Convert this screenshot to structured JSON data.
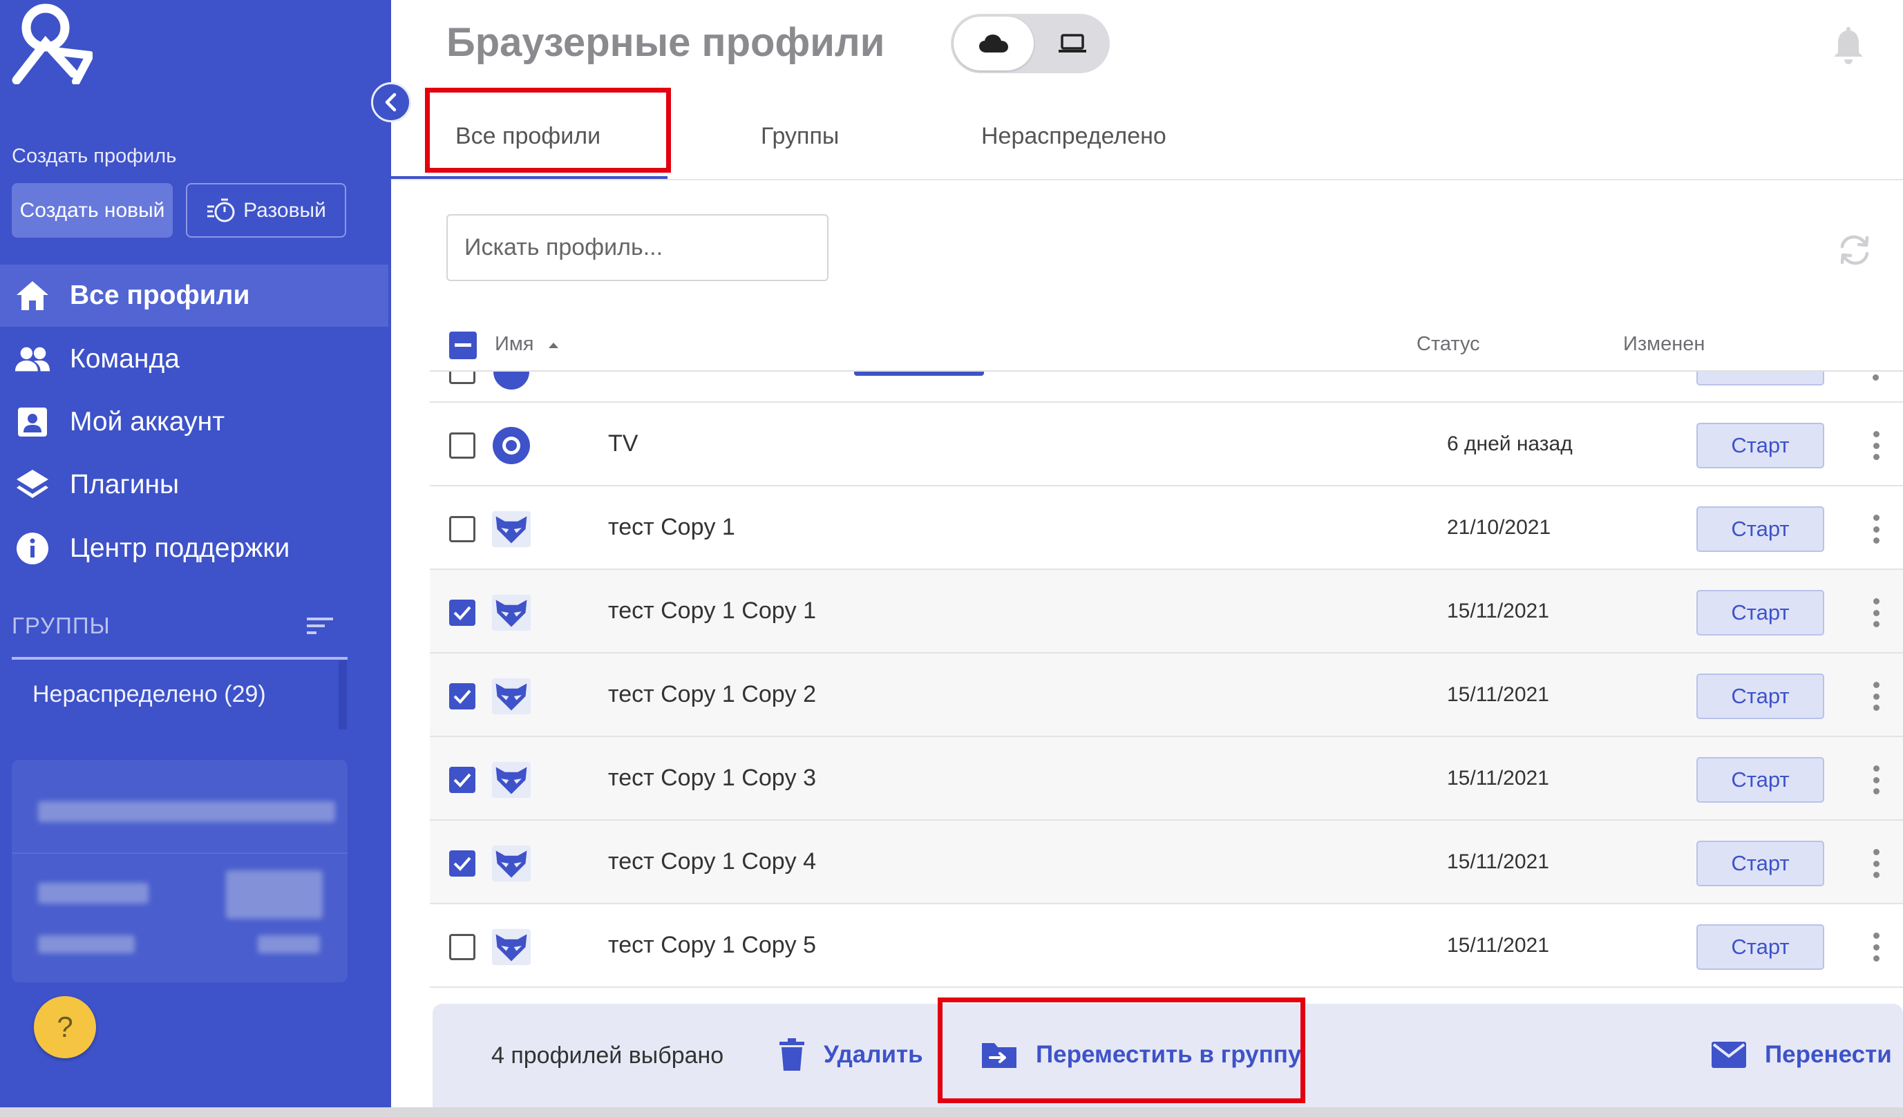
{
  "sidebar": {
    "create_label": "Создать профиль",
    "create_new_label": "Создать новый",
    "one_time_label": "Разовый",
    "nav": [
      {
        "label": "Все профили",
        "icon": "home-icon",
        "active": true
      },
      {
        "label": "Команда",
        "icon": "team-icon",
        "active": false
      },
      {
        "label": "Мой аккаунт",
        "icon": "account-icon",
        "active": false
      },
      {
        "label": "Плагины",
        "icon": "layers-icon",
        "active": false
      },
      {
        "label": "Центр поддержки",
        "icon": "info-icon",
        "active": false
      }
    ],
    "groups_title": "ГРУППЫ",
    "group_unassigned": "Нераспределено (29)",
    "help_label": "?"
  },
  "header": {
    "title": "Браузерные профили",
    "mode_selected": "cloud"
  },
  "tabs": [
    {
      "label": "Все профили",
      "active": true
    },
    {
      "label": "Группы",
      "active": false
    },
    {
      "label": "Нераспределено",
      "active": false
    }
  ],
  "search": {
    "placeholder": "Искать профиль..."
  },
  "table": {
    "columns": {
      "name": "Имя",
      "status": "Статус",
      "modified": "Изменен"
    },
    "start_label": "Старт",
    "rows": [
      {
        "name": "TV",
        "modified": "6 дней назад",
        "checked": false,
        "avatar": "circle-browser-icon"
      },
      {
        "name": "тест Copy 1",
        "modified": "21/10/2021",
        "checked": false,
        "avatar": "fox-icon"
      },
      {
        "name": "тест Copy 1 Copy 1",
        "modified": "15/11/2021",
        "checked": true,
        "avatar": "fox-icon"
      },
      {
        "name": "тест Copy 1 Copy 2",
        "modified": "15/11/2021",
        "checked": true,
        "avatar": "fox-icon"
      },
      {
        "name": "тест Copy 1 Copy 3",
        "modified": "15/11/2021",
        "checked": true,
        "avatar": "fox-icon"
      },
      {
        "name": "тест Copy 1 Copy 4",
        "modified": "15/11/2021",
        "checked": true,
        "avatar": "fox-icon"
      },
      {
        "name": "тест Copy 1 Copy 5",
        "modified": "15/11/2021",
        "checked": false,
        "avatar": "fox-icon"
      }
    ]
  },
  "action_bar": {
    "selected_text": "4 профилей выбрано",
    "delete_label": "Удалить",
    "move_to_group_label": "Переместить в группу",
    "transfer_label": "Перенести"
  },
  "colors": {
    "brand": "#3e52c9",
    "highlight": "#e3000f",
    "help": "#f5c542"
  }
}
